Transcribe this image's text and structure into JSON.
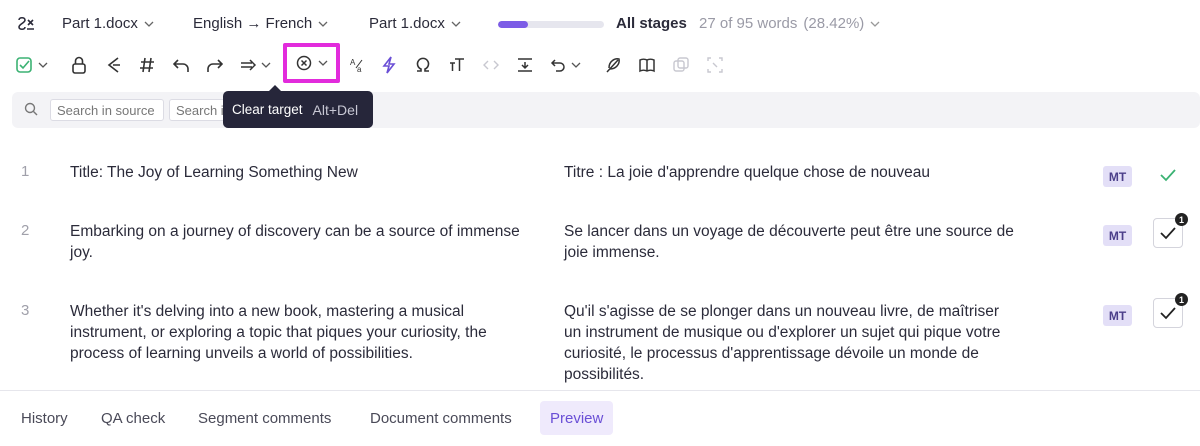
{
  "header": {
    "file_menu": "Part 1.docx",
    "language_pair": "English → French",
    "document_menu": "Part 1.docx",
    "progress_fraction": 0.2842,
    "stage_label": "All stages",
    "word_count": "27 of 95 words",
    "percent": "(28.42%)"
  },
  "toolbar": {
    "highlighted_tool": "clear-target"
  },
  "search": {
    "source_placeholder": "Search in source",
    "target_placeholder": "Search i"
  },
  "tooltip": {
    "title": "Clear target",
    "shortcut": "Alt+Del"
  },
  "segments": [
    {
      "number": "1",
      "source": "Title: The Joy of Learning Something New",
      "target": "Titre : La joie d'apprendre quelque chose de nouveau",
      "badge": "MT",
      "status": "confirmed"
    },
    {
      "number": "2",
      "source": "Embarking on a journey of discovery can be a source of immense joy.",
      "target": "Se lancer dans un voyage de découverte peut être une source de joie immense.",
      "badge": "MT",
      "notification": "1"
    },
    {
      "number": "3",
      "source": "Whether it's delving into a new book, mastering a musical instrument, or exploring a topic that piques your curiosity, the process of learning unveils a world of possibilities.",
      "target": "Qu'il s'agisse de se plonger dans un nouveau livre, de maîtriser un instrument de musique ou d'explorer un sujet qui pique votre curiosité, le processus d'apprentissage dévoile un monde de possibilités.",
      "badge": "MT",
      "notification": "1"
    }
  ],
  "bottom_tabs": [
    "History",
    "QA check",
    "Segment comments",
    "Document comments",
    "Preview"
  ],
  "colors": {
    "accent": "#7c5ce6",
    "highlight": "#e22bdc",
    "confirmed": "#3bb273",
    "badge_bg": "#e3dff7"
  }
}
